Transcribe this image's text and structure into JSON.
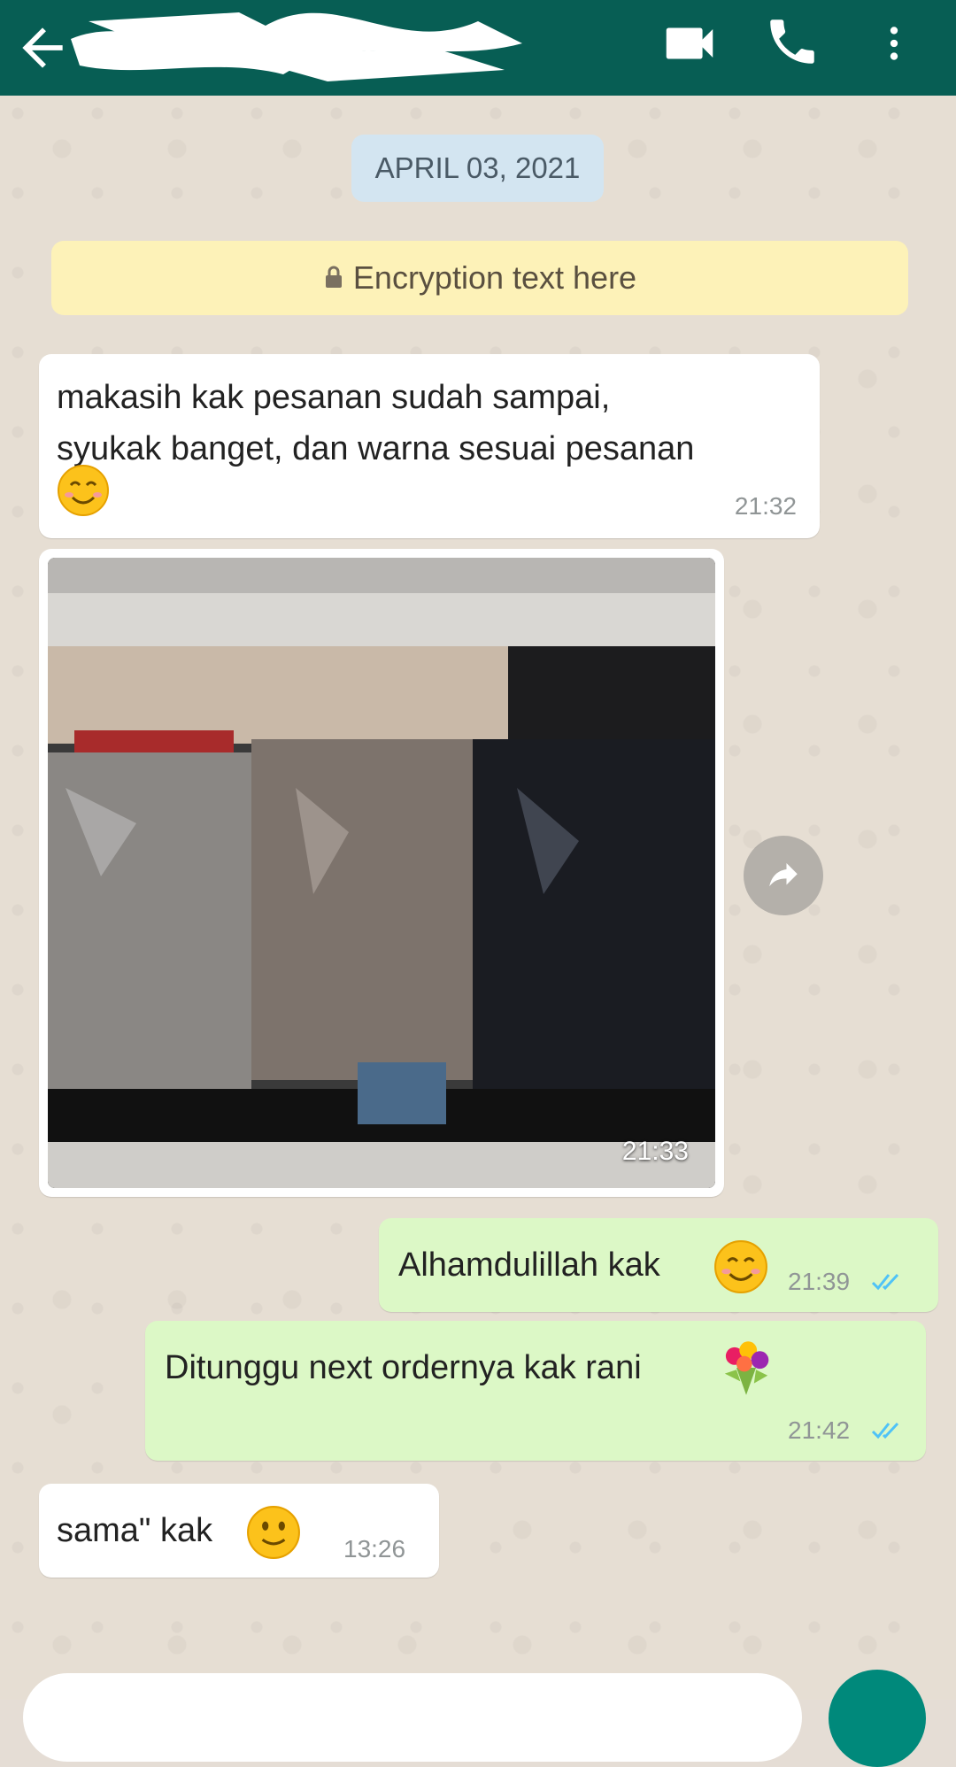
{
  "header": {
    "contact_name": "",
    "icons": {
      "back": "arrow-left-icon",
      "video": "video-call-icon",
      "call": "phone-icon",
      "menu": "more-vert-icon"
    },
    "color": "#075e54"
  },
  "date_label": "APRIL 03, 2021",
  "encryption_text": "Encryption text here",
  "messages": [
    {
      "direction": "incoming",
      "lines": [
        "makasih kak pesanan sudah sampai,",
        "syukak banget, dan warna sesuai pesanan"
      ],
      "emoji": "smiling-face",
      "time": "21:32"
    },
    {
      "direction": "incoming",
      "type": "image",
      "description_icon": "photo-of-packaged-clothes",
      "time": "21:33"
    },
    {
      "direction": "outgoing",
      "text": "Alhamdulillah kak",
      "emoji": "smiling-face",
      "time": "21:39",
      "status": "read"
    },
    {
      "direction": "outgoing",
      "text": "Ditunggu next ordernya kak rani",
      "emoji": "bouquet",
      "time": "21:42",
      "status": "read"
    },
    {
      "direction": "incoming",
      "text": "sama\" kak",
      "emoji": "slight-smile",
      "time": "13:26"
    }
  ],
  "colors": {
    "incoming": "#ffffff",
    "outgoing": "#dcf8c6",
    "tick_read": "#4fc3f7"
  }
}
